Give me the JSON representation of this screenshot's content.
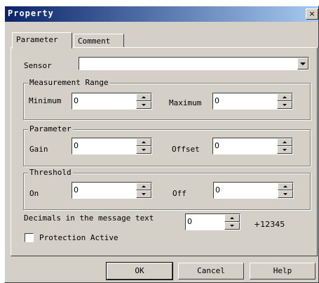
{
  "window": {
    "title": "Property",
    "close_glyph": "×"
  },
  "tabs": [
    {
      "label": "Parameter"
    },
    {
      "label": "Comment"
    }
  ],
  "sensor": {
    "label": "Sensor",
    "value": ""
  },
  "measurement_range": {
    "title": "Measurement Range",
    "minimum_label": "Minimum",
    "minimum_value": "0",
    "maximum_label": "Maximum",
    "maximum_value": "0"
  },
  "parameter_group": {
    "title": "Parameter",
    "gain_label": "Gain",
    "gain_value": "0",
    "offset_label": "Offset",
    "offset_value": "0"
  },
  "threshold": {
    "title": "Threshold",
    "on_label": "On",
    "on_value": "0",
    "off_label": "Off",
    "off_value": "0"
  },
  "decimals": {
    "label": "Decimals in the message text",
    "value": "0",
    "preview": "+12345"
  },
  "protection": {
    "label": "Protection Active",
    "checked": false
  },
  "buttons": {
    "ok": "OK",
    "cancel": "Cancel",
    "help": "Help"
  },
  "icons": [
    "close-icon",
    "dropdown-arrow-icon",
    "spin-up-icon",
    "spin-down-icon"
  ]
}
